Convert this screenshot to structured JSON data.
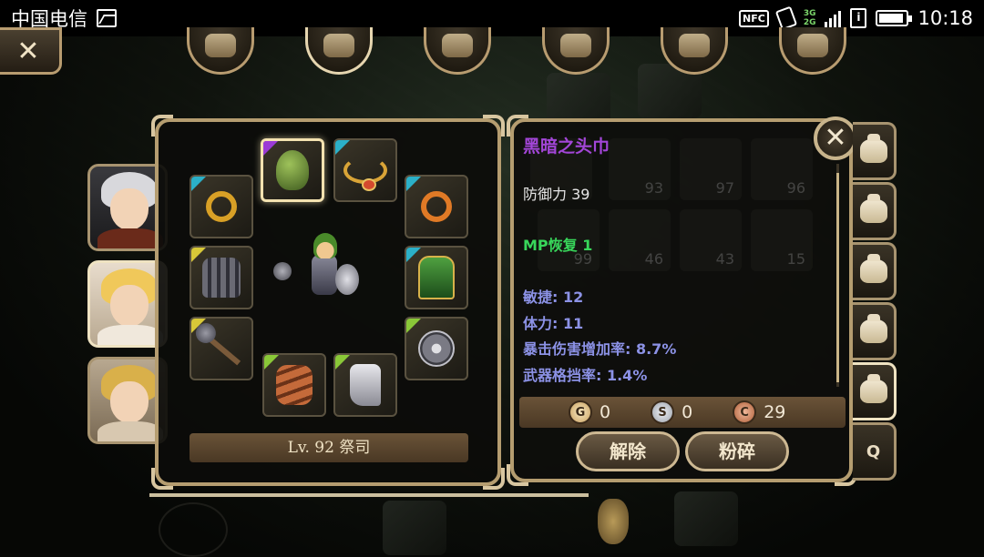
{
  "status_bar": {
    "carrier": "中国电信",
    "nfc": "NFC",
    "network_top": "3G",
    "network_bottom": "2G",
    "sim": "i",
    "time": "10:18",
    "battery_level": 0.8
  },
  "top_nav": {
    "close_glyph": "✕",
    "buttons": [
      "helmet-icon",
      "bag-icon",
      "compass-icon",
      "party-icon",
      "scroll-icon",
      "gear-icon"
    ]
  },
  "characters": [
    {
      "name": "white-haired-warrior",
      "hair": "#d8d8dc",
      "body": "#6a2a1a",
      "active": false
    },
    {
      "name": "blonde-priestess",
      "hair": "#f0c85a",
      "body": "#f0e8dc",
      "active": true
    },
    {
      "name": "blonde-priestess-alt",
      "hair": "#d9b04a",
      "body": "#d8c8b0",
      "active": false
    }
  ],
  "equipment": {
    "level_label": "Lv. 92 祭司",
    "slots": [
      {
        "name": "hood",
        "rarity_color": "#9b3ad6",
        "selected": true
      },
      {
        "name": "necklace",
        "rarity_color": "#2bb0c8",
        "selected": false
      },
      {
        "name": "ring-left",
        "rarity_color": "#2bb0c8",
        "selected": false
      },
      {
        "name": "ring-right",
        "rarity_color": "#2bb0c8",
        "selected": false
      },
      {
        "name": "armor",
        "rarity_color": "#d8c838",
        "selected": false
      },
      {
        "name": "cloak",
        "rarity_color": "#2bb0c8",
        "selected": false
      },
      {
        "name": "mace",
        "rarity_color": "#d8c838",
        "selected": false
      },
      {
        "name": "shield",
        "rarity_color": "#8ac838",
        "selected": false
      },
      {
        "name": "gloves",
        "rarity_color": "#8ac838",
        "selected": false
      },
      {
        "name": "boots",
        "rarity_color": "#8ac838",
        "selected": false
      }
    ]
  },
  "item_detail": {
    "name": "黑暗之头巾",
    "name_color": "#a346d8",
    "defense": "防御力 39",
    "special": "MP恢复 1",
    "stats": [
      "敏捷: 12",
      "体力: 11",
      "暴击伤害增加率: 8.7%",
      "武器格挡率: 1.4%"
    ],
    "background_counts": [
      "93",
      "97",
      "96",
      "99",
      "46",
      "43",
      "15"
    ]
  },
  "currency": {
    "gold": {
      "symbol": "G",
      "value": "0",
      "color": "#e8c890"
    },
    "silver": {
      "symbol": "S",
      "value": "0",
      "color": "#c8ccd4"
    },
    "copper": {
      "symbol": "C",
      "value": "29",
      "color": "#d88a62"
    }
  },
  "actions": {
    "unequip": "解除",
    "shatter": "粉碎"
  },
  "bag_tabs": {
    "count": 5,
    "active_index": 4,
    "search_glyph": "Q"
  }
}
